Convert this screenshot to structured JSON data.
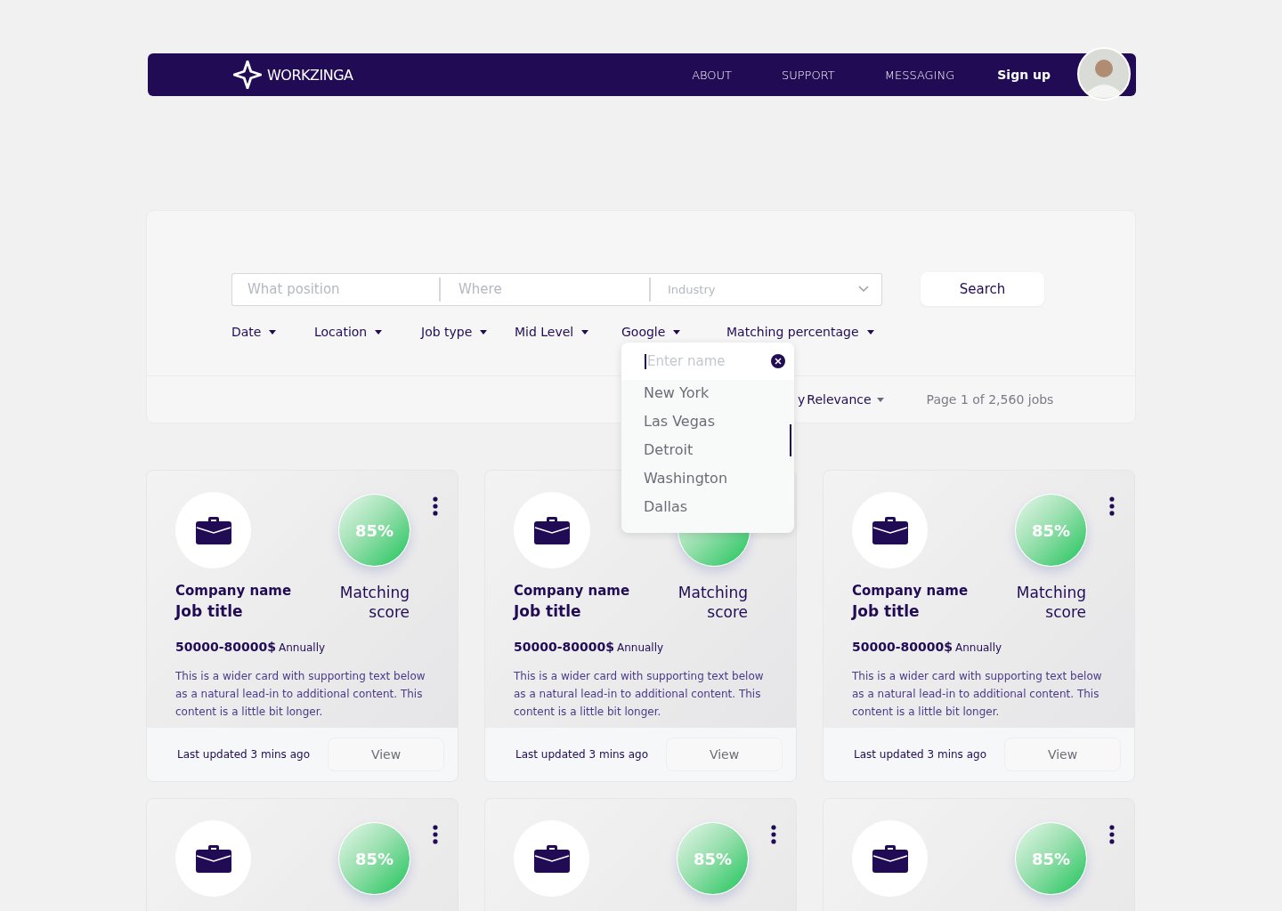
{
  "nav": {
    "brand": "WORKZINGA",
    "links": [
      "ABOUT",
      "SUPPORT",
      "MESSAGING"
    ],
    "signup": "Sign up"
  },
  "search": {
    "fields": [
      {
        "placeholder": "What position"
      },
      {
        "placeholder": "Where"
      },
      {
        "placeholder": "Industry"
      }
    ],
    "button": "Search"
  },
  "filters": [
    "Date",
    "Location",
    "Job type",
    "Mid Level",
    "Google",
    "Matching percentage"
  ],
  "sort": {
    "label": "y",
    "value": "Relevance"
  },
  "pagination": "Page 1 of 2,560 jobs",
  "dropdown": {
    "placeholder": "Enter name",
    "options": [
      "New York",
      "Las Vegas",
      "Detroit",
      "Washington",
      "Dallas"
    ]
  },
  "cards": [
    {
      "company": "Company name",
      "job_title": "Job title",
      "score": "85%",
      "more_menu": true,
      "score_label": "Matching score",
      "salary": "50000-80000$",
      "period": "Annually",
      "description": "This is a wider card with supporting text below as a natural lead-in to additional content. This content is a little bit longer.",
      "updated": "Last updated 3 mins ago",
      "button": "View"
    },
    {
      "company": "Company name",
      "job_title": "Job title",
      "more_menu": false,
      "score_label": "Matching score",
      "salary": "50000-80000$",
      "period": "Annually",
      "description": "This is a wider card with supporting text below as a natural lead-in to additional content. This content is a little bit longer.",
      "updated": "Last updated 3 mins ago",
      "button": "View"
    },
    {
      "company": "Company name",
      "job_title": "Job title",
      "score": "85%",
      "more_menu": true,
      "score_label": "Matching score",
      "salary": "50000-80000$",
      "period": "Annually",
      "description": "This is a wider card with supporting text below as a natural lead-in to additional content. This content is a little bit longer.",
      "updated": "Last updated 3 mins ago",
      "button": "View"
    },
    {
      "score": "85%",
      "more_menu": true
    },
    {
      "score": "85%",
      "more_menu": true
    },
    {
      "score": "85%",
      "more_menu": true
    }
  ]
}
